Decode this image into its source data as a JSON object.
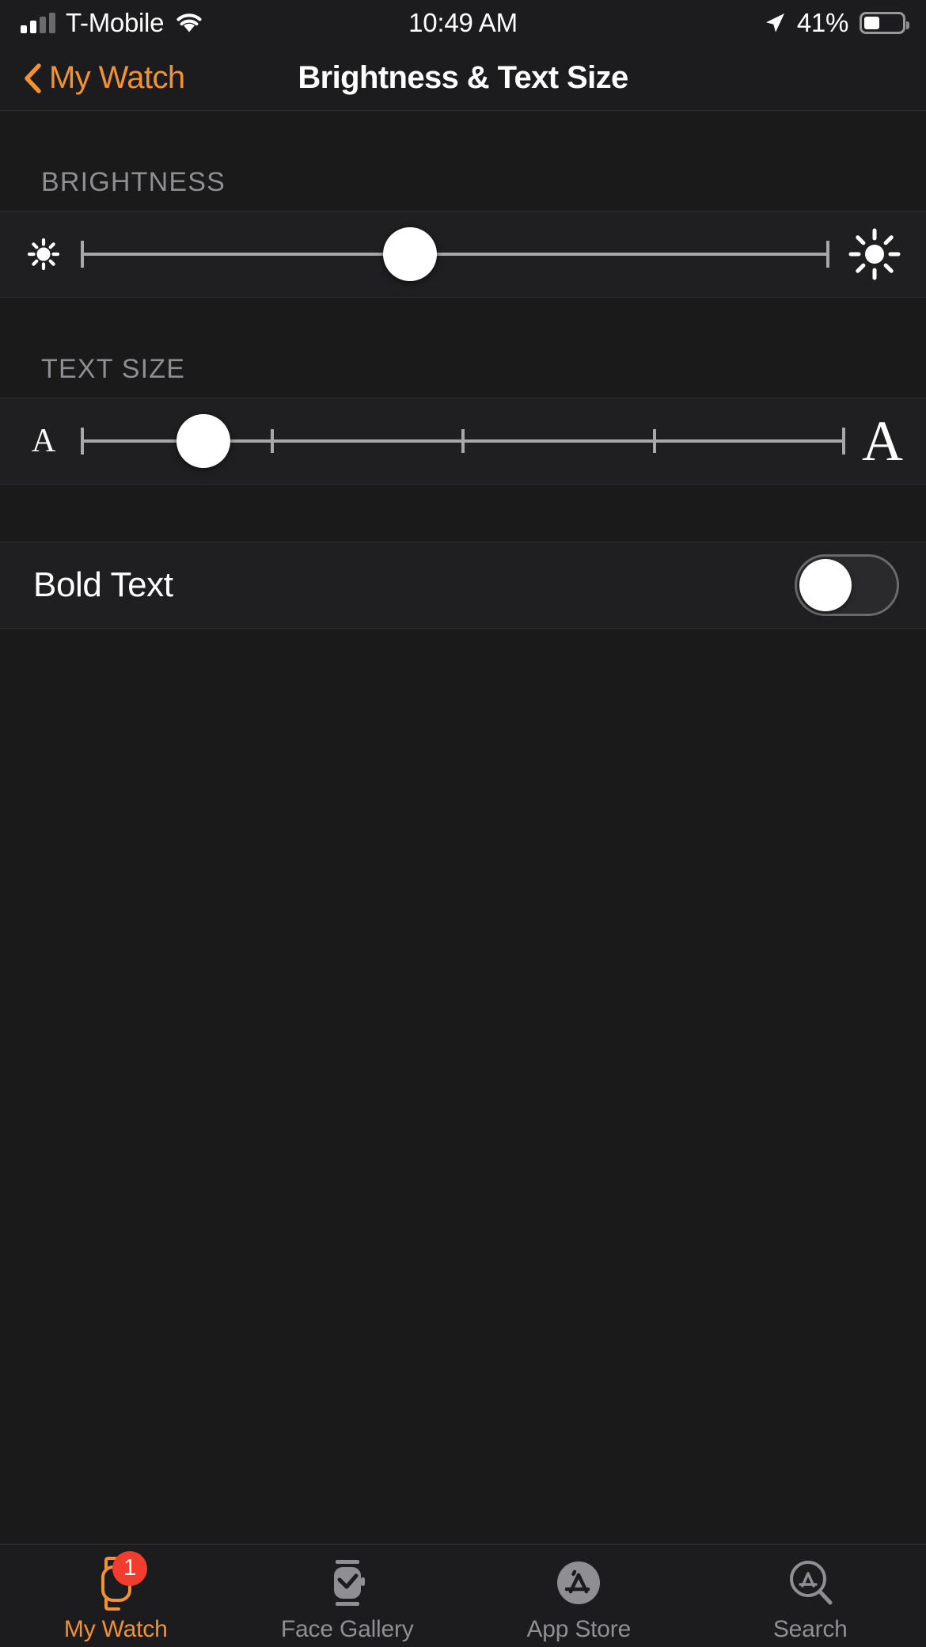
{
  "status_bar": {
    "carrier": "T-Mobile",
    "signal_bars_filled": 2,
    "signal_bars_total": 4,
    "wifi_icon": "wifi-icon",
    "time": "10:49 AM",
    "location_icon": "location-arrow-icon",
    "battery_percent": "41%",
    "battery_level": 41
  },
  "nav": {
    "back_icon": "chevron-left-icon",
    "back_label": "My Watch",
    "title": "Brightness & Text Size",
    "accent_color": "#f29233"
  },
  "sections": {
    "brightness": {
      "header": "BRIGHTNESS",
      "left_icon": "sun-small-icon",
      "right_icon": "sun-large-icon",
      "value_percent": 44,
      "min": 0,
      "max": 100
    },
    "text_size": {
      "header": "TEXT SIZE",
      "left_icon": "letter-a-small-icon",
      "right_icon": "letter-a-large-icon",
      "steps": 5,
      "selected_step": 2,
      "value_percent": 16
    },
    "bold_text": {
      "label": "Bold Text",
      "enabled": false
    }
  },
  "tabs": [
    {
      "label": "My Watch",
      "icon": "watch-icon",
      "active": true,
      "badge": "1"
    },
    {
      "label": "Face Gallery",
      "icon": "watch-face-icon",
      "active": false,
      "badge": ""
    },
    {
      "label": "App Store",
      "icon": "app-store-icon",
      "active": false,
      "badge": ""
    },
    {
      "label": "Search",
      "icon": "app-store-search-icon",
      "active": false,
      "badge": ""
    }
  ]
}
